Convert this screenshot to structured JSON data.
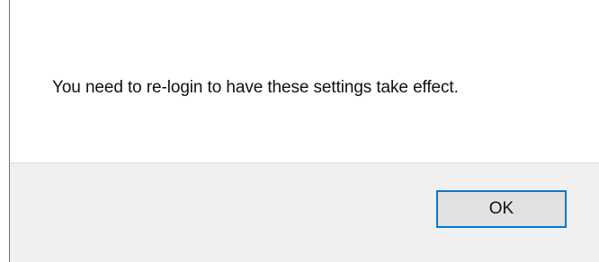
{
  "dialog": {
    "message": "You need to re-login to have these settings take effect.",
    "ok_label": "OK"
  },
  "colors": {
    "content_background": "#ffffff",
    "footer_background": "#f0f0f0",
    "button_background": "#e1e1e1",
    "button_focus_border": "#0078d7",
    "text": "#111111"
  }
}
